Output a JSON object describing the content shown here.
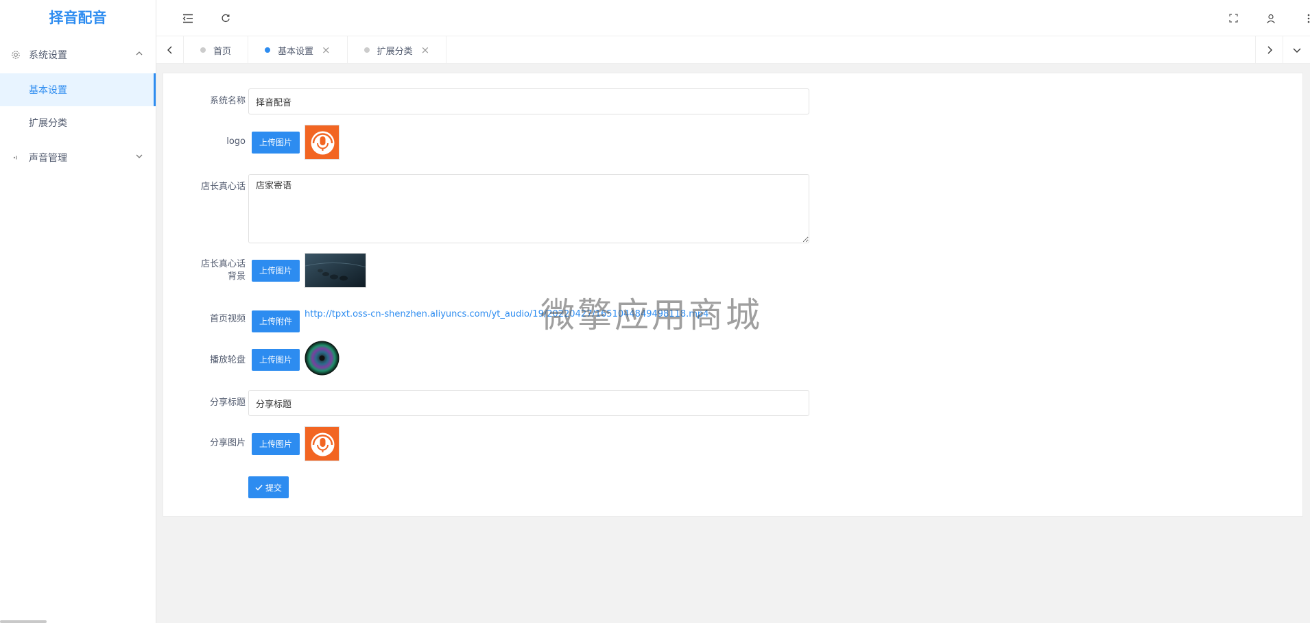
{
  "app": {
    "title": "择音配音"
  },
  "sidebar": {
    "groups": [
      {
        "label": "系统设置",
        "icon": "gear-icon",
        "expanded": true,
        "items": [
          {
            "label": "基本设置",
            "active": true
          },
          {
            "label": "扩展分类",
            "active": false
          }
        ]
      },
      {
        "label": "声音管理",
        "icon": "sound-icon",
        "expanded": false,
        "items": []
      }
    ]
  },
  "header": {
    "icons": [
      "menu-fold-icon",
      "refresh-icon",
      "fullscreen-icon",
      "user-icon",
      "more-vertical-icon"
    ]
  },
  "tabs": [
    {
      "label": "首页",
      "active": false,
      "closable": false
    },
    {
      "label": "基本设置",
      "active": true,
      "closable": true
    },
    {
      "label": "扩展分类",
      "active": false,
      "closable": true
    }
  ],
  "form": {
    "system_name": {
      "label": "系统名称",
      "value": "择音配音"
    },
    "logo": {
      "label": "logo",
      "button": "上传图片"
    },
    "owner_message": {
      "label": "店长真心话",
      "value": "店家寄语"
    },
    "owner_message_bg": {
      "label_line1": "店长真心话",
      "label_line2": "背景",
      "button": "上传图片"
    },
    "home_video": {
      "label": "首页视频",
      "button": "上传附件",
      "url": "http://tpxt.oss-cn-shenzhen.aliyuncs.com/yt_audio/19/20220427/1651044849498118.mp4"
    },
    "play_disc": {
      "label": "播放轮盘",
      "button": "上传图片"
    },
    "share_title": {
      "label": "分享标题",
      "value": "分享标题"
    },
    "share_image": {
      "label": "分享图片",
      "button": "上传图片"
    },
    "submit": "提交"
  },
  "watermark": "微擎应用商城",
  "colors": {
    "accent": "#2d8cf0",
    "logo_orange": "#f26522"
  }
}
